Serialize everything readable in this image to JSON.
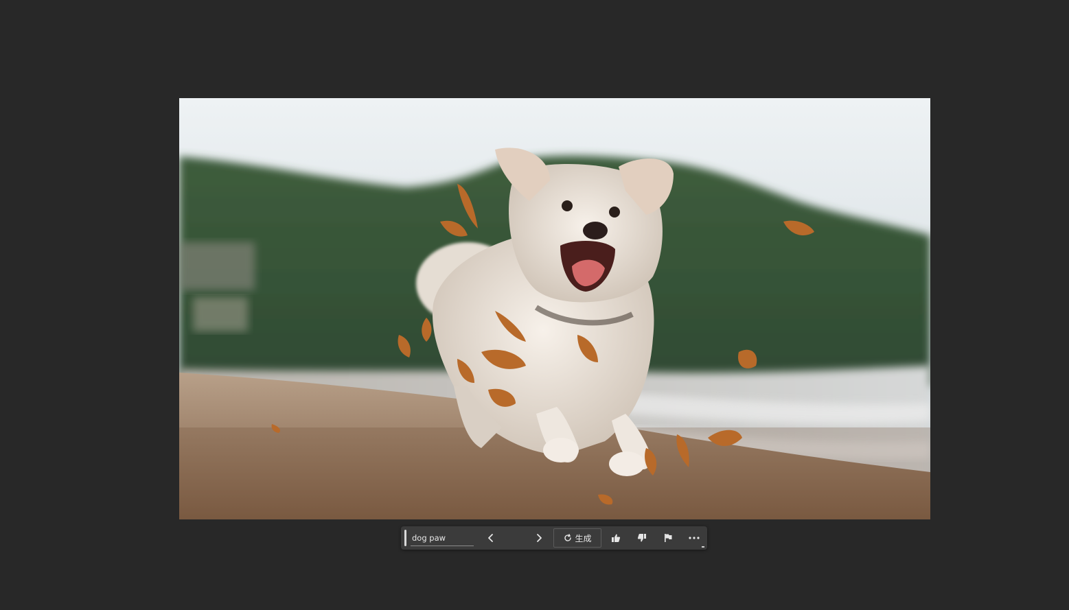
{
  "canvas": {
    "background": "#282828",
    "image": {
      "subject": "dog-running-on-beach",
      "sky_color": "#dfe6ea",
      "hill_color": "#3c5a3a",
      "sand_color": "#a98a6c",
      "dog_color": "#efe6dc",
      "leaf_color": "#b86a2a"
    }
  },
  "contextual_taskbar": {
    "prompt": {
      "value": "dog paw",
      "placeholder": ""
    },
    "prev_icon": "chevron-left-icon",
    "next_icon": "chevron-right-icon",
    "generate_label": "生成",
    "generate_icon": "refresh-icon",
    "like_icon": "thumbs-up-icon",
    "dislike_icon": "thumbs-down-icon",
    "report_icon": "flag-icon",
    "more_icon": "more-icon"
  }
}
